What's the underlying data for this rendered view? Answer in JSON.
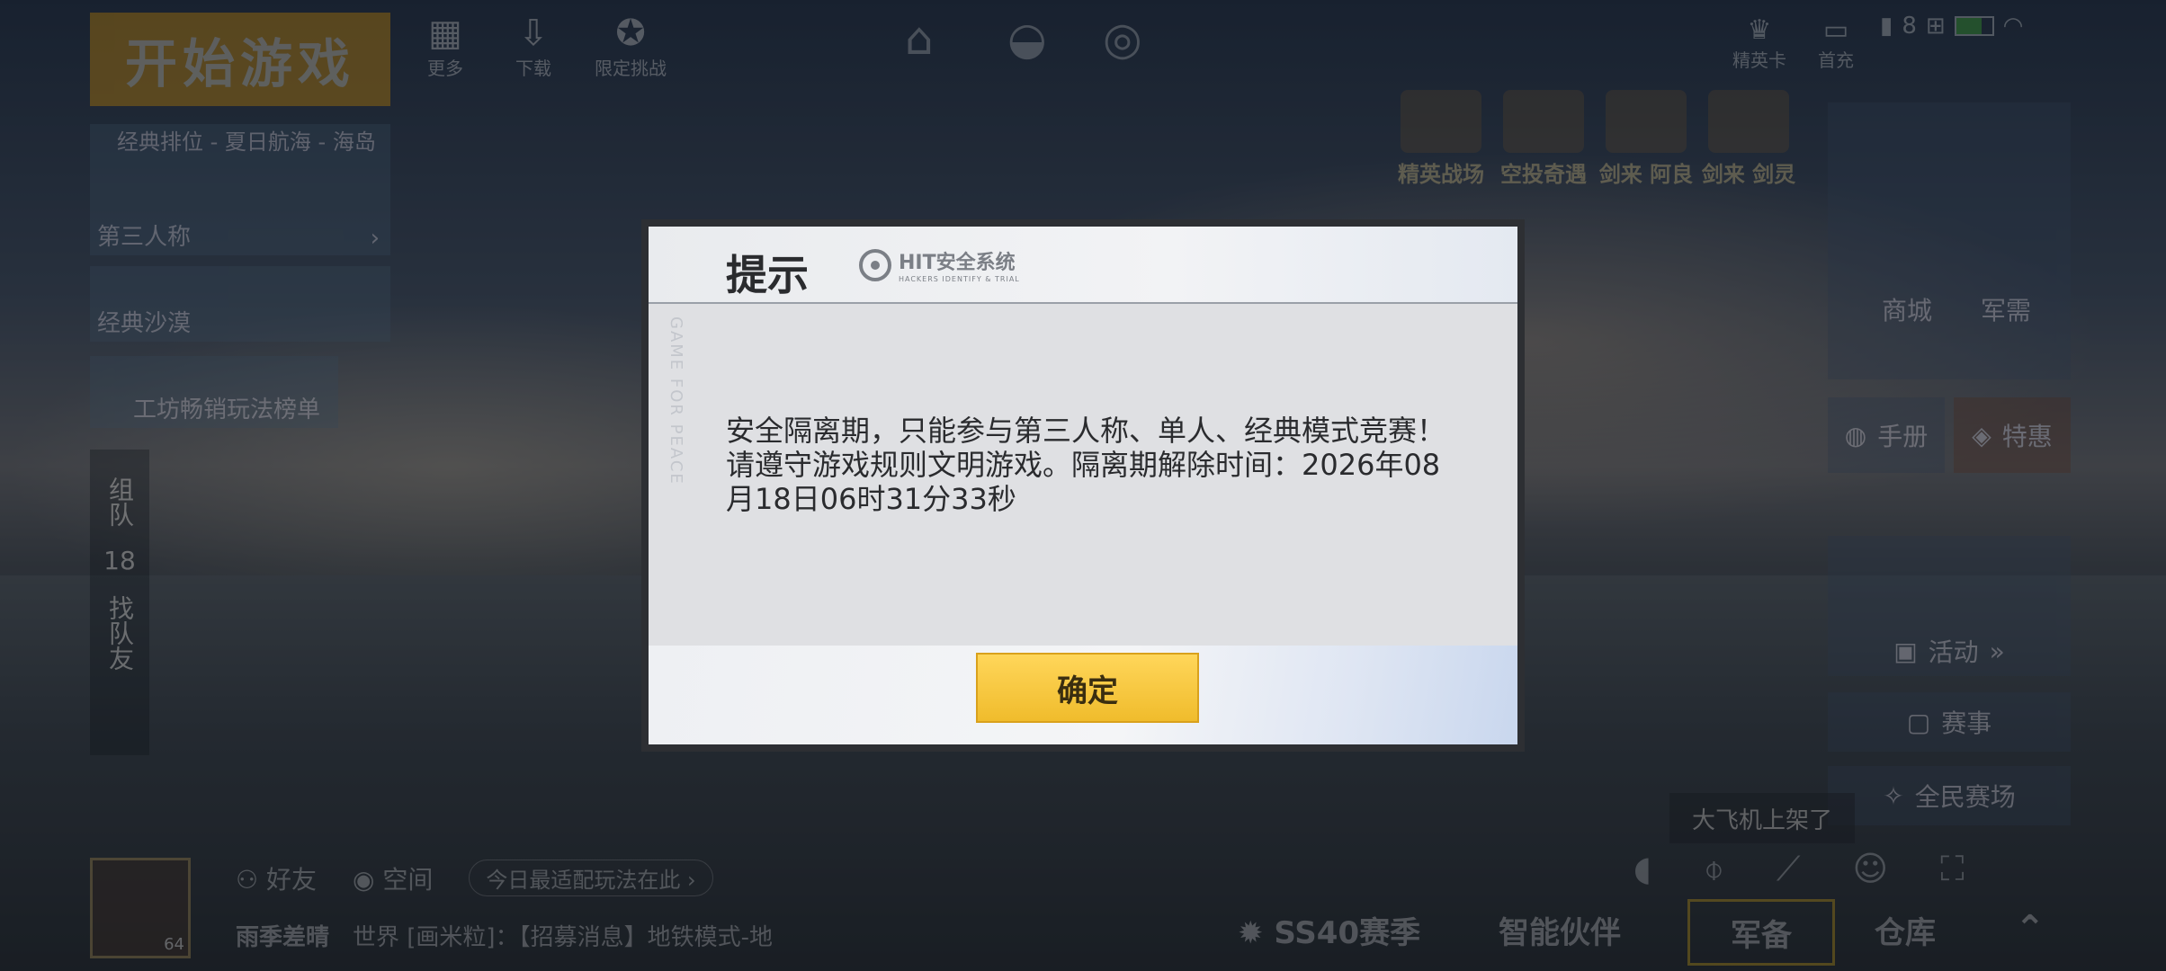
{
  "top_left": {
    "start_game": "开始游戏",
    "more": "更多",
    "download": "下载",
    "limited_challenge": "限定挑战"
  },
  "modes": {
    "card1_title": "经典排位 - 夏日航海 - 海岛",
    "card1_label": "第三人称",
    "card2_label": "经典沙漠",
    "card3_label": "工坊畅销玩法榜单"
  },
  "side_tab": {
    "team": "组队",
    "team_count": "18",
    "find_team": "找队友"
  },
  "top_right": {
    "elite_card": "精英卡",
    "first_recharge": "首充",
    "signal_count": "8"
  },
  "events": [
    "精英战场",
    "空投奇遇",
    "剑来 阿良",
    "剑来 剑灵"
  ],
  "right_panel": {
    "shop": "商城",
    "supply": "军需",
    "handbook": "手册",
    "special": "特惠",
    "activity": "活动",
    "match": "赛事",
    "all_people_arena": "全民赛场"
  },
  "notice": "大飞机上架了",
  "social": {
    "friends": "好友",
    "space": "空间",
    "today_tip": "今日最适配玩法在此",
    "username": "雨季差晴",
    "level": "64",
    "chat": "世界 [画米粒]：【招募消息】地铁模式-地"
  },
  "bottom_nav": {
    "season": "SS40赛季",
    "partner": "智能伙伴",
    "equipment": "军备",
    "warehouse": "仓库"
  },
  "dialog": {
    "title": "提示",
    "brand": "HIT安全系统",
    "brand_sub": "HACKERS IDENTIFY & TRIAL",
    "deco_text": "GAME FOR PEACE",
    "message": "安全隔离期，只能参与第三人称、单人、经典模式竞赛！请遵守游戏规则文明游戏。隔离期解除时间：2026年08月18日06时31分33秒",
    "confirm": "确定"
  },
  "colors": {
    "start_button": "#f1ac1e",
    "confirm_button": "#f5c63f",
    "dialog_frame": "#2d2f33",
    "dialog_body": "#dfe0e3"
  }
}
